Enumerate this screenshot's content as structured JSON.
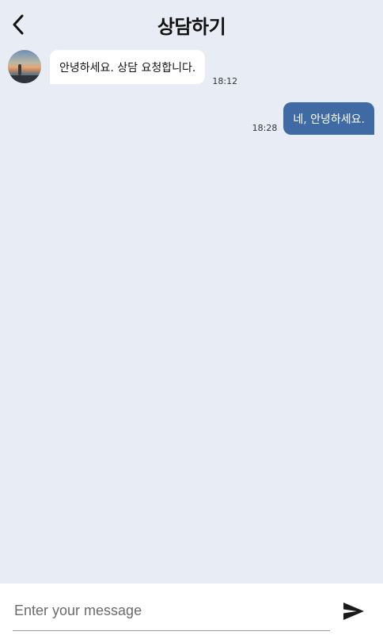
{
  "header": {
    "title": "상담하기",
    "back_icon": "chevron-left-icon"
  },
  "messages": [
    {
      "direction": "incoming",
      "text": "안녕하세요. 상담 요청합니다.",
      "time": "18:12",
      "avatar": "avatar-image"
    },
    {
      "direction": "outgoing",
      "text": "네, 안녕하세요.",
      "time": "18:28"
    }
  ],
  "composer": {
    "placeholder": "Enter your message",
    "value": "",
    "send_icon": "send-icon"
  },
  "colors": {
    "background": "#e8ecf5",
    "incoming_bubble": "#ffffff",
    "outgoing_bubble": "#3f6aa3",
    "composer": "#ffffff"
  }
}
